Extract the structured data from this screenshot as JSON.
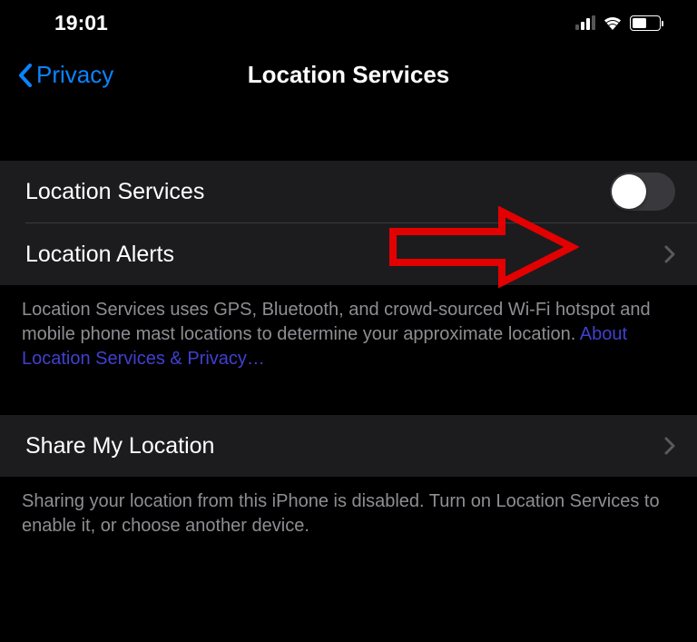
{
  "statusBar": {
    "time": "19:01"
  },
  "nav": {
    "backLabel": "Privacy",
    "title": "Location Services"
  },
  "cells": {
    "locationServices": "Location Services",
    "locationAlerts": "Location Alerts",
    "shareMyLocation": "Share My Location"
  },
  "footers": {
    "servicesDescPrefix": "Location Services uses GPS, Bluetooth, and crowd-sourced Wi-Fi hotspot and mobile phone mast locations to determine your approximate location. ",
    "servicesLink": "About Location Services & Privacy…",
    "shareDesc": "Sharing your location from this iPhone is disabled. Turn on Location Services to enable it, or choose another device."
  }
}
